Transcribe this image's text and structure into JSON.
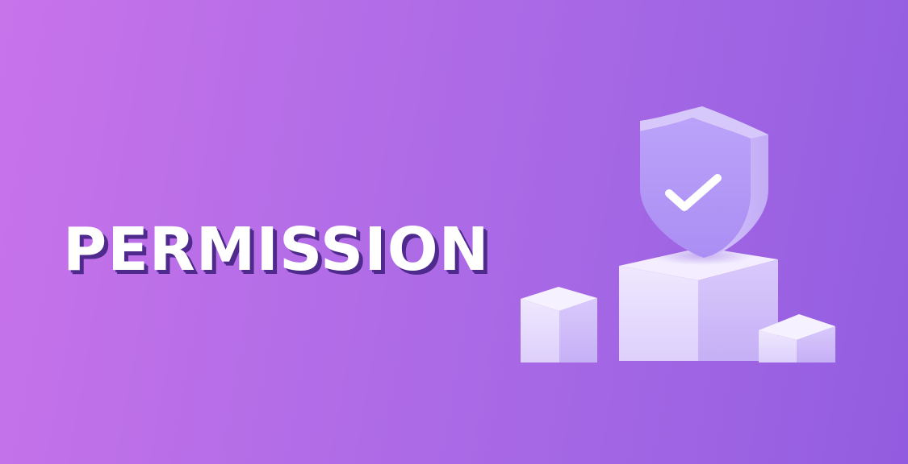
{
  "banner": {
    "title": "PERMISSION",
    "illustration_icon": "shield-check-icon"
  },
  "colors": {
    "background_start": "#c873ea",
    "background_end": "#925ce0",
    "title_text": "#ffffff",
    "title_shadow": "#4f2a8d",
    "shield_face": "#b79bf7",
    "cube_light": "#ece3ff"
  }
}
